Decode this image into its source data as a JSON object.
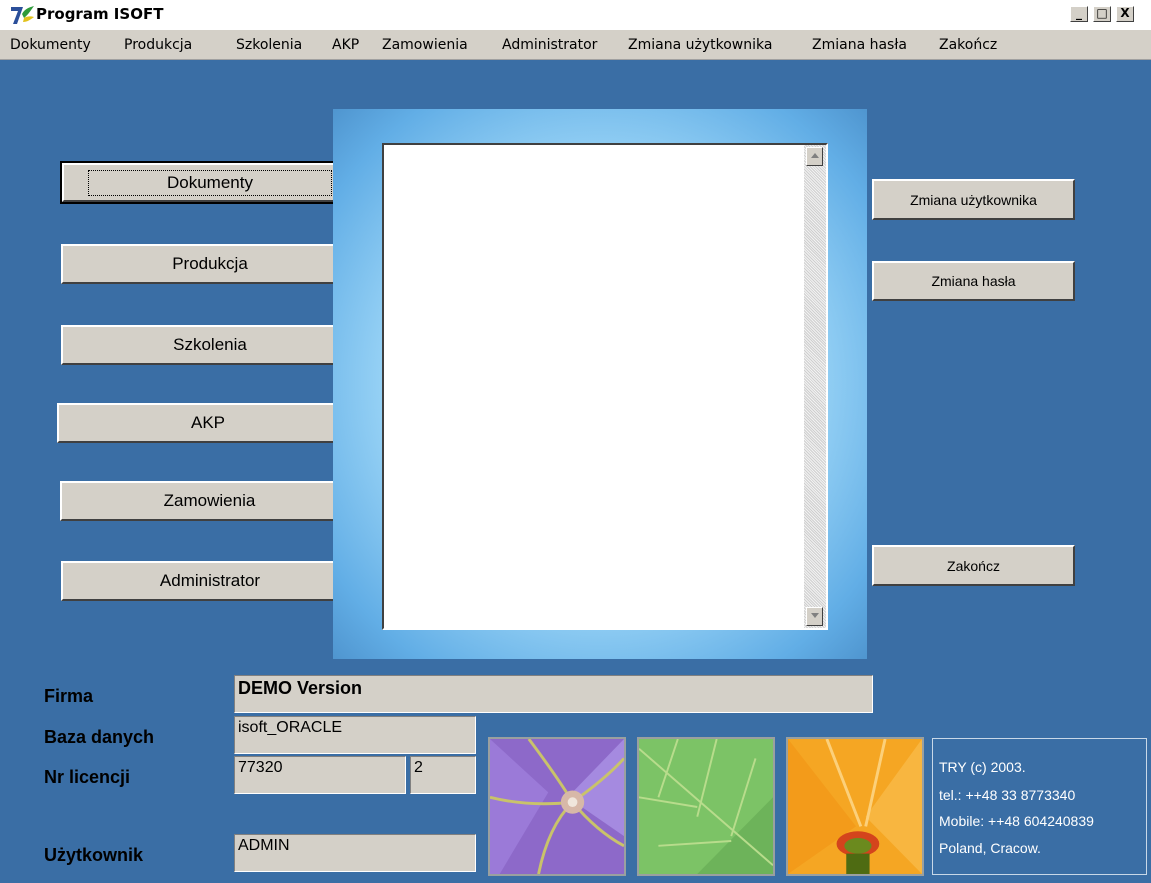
{
  "window": {
    "title": "Program ISOFT",
    "controls": {
      "minimize": "_",
      "maximize": "□",
      "close": "X"
    }
  },
  "menu": [
    "Dokumenty",
    "Produkcja",
    "Szkolenia",
    "AKP",
    "Zamowienia",
    "Administrator",
    "Zmiana użytkownika",
    "Zmiana hasła",
    "Zakończ"
  ],
  "left_buttons": [
    "Dokumenty",
    "Produkcja",
    "Szkolenia",
    "AKP",
    "Zamowienia",
    "Administrator"
  ],
  "right_buttons": {
    "change_user": "Zmiana użytkownika",
    "change_password": "Zmiana hasła",
    "quit": "Zakończ"
  },
  "info_fields": {
    "firma_label": "Firma",
    "firma_value": "DEMO Version",
    "baza_label": "Baza danych",
    "baza_value": "isoft_ORACLE",
    "licencja_label": "Nr licencji",
    "licencja_value": "77320",
    "licencja_count": "2",
    "user_label": "Użytkownik",
    "user_value": "ADMIN"
  },
  "footer": {
    "lines": [
      "TRY (c) 2003.",
      "tel.: ++48 33 8773340",
      "Mobile: ++48 604240839",
      "Poland, Cracow."
    ]
  },
  "icons": {
    "app": "app-logo-icon",
    "tiles": [
      "purple-flower-tile",
      "green-leaf-tile",
      "orange-flower-tile"
    ]
  },
  "colors": {
    "desktop": "#3a6ea5",
    "button_face": "#d4d0c8",
    "glow": "#9ad4f6"
  }
}
